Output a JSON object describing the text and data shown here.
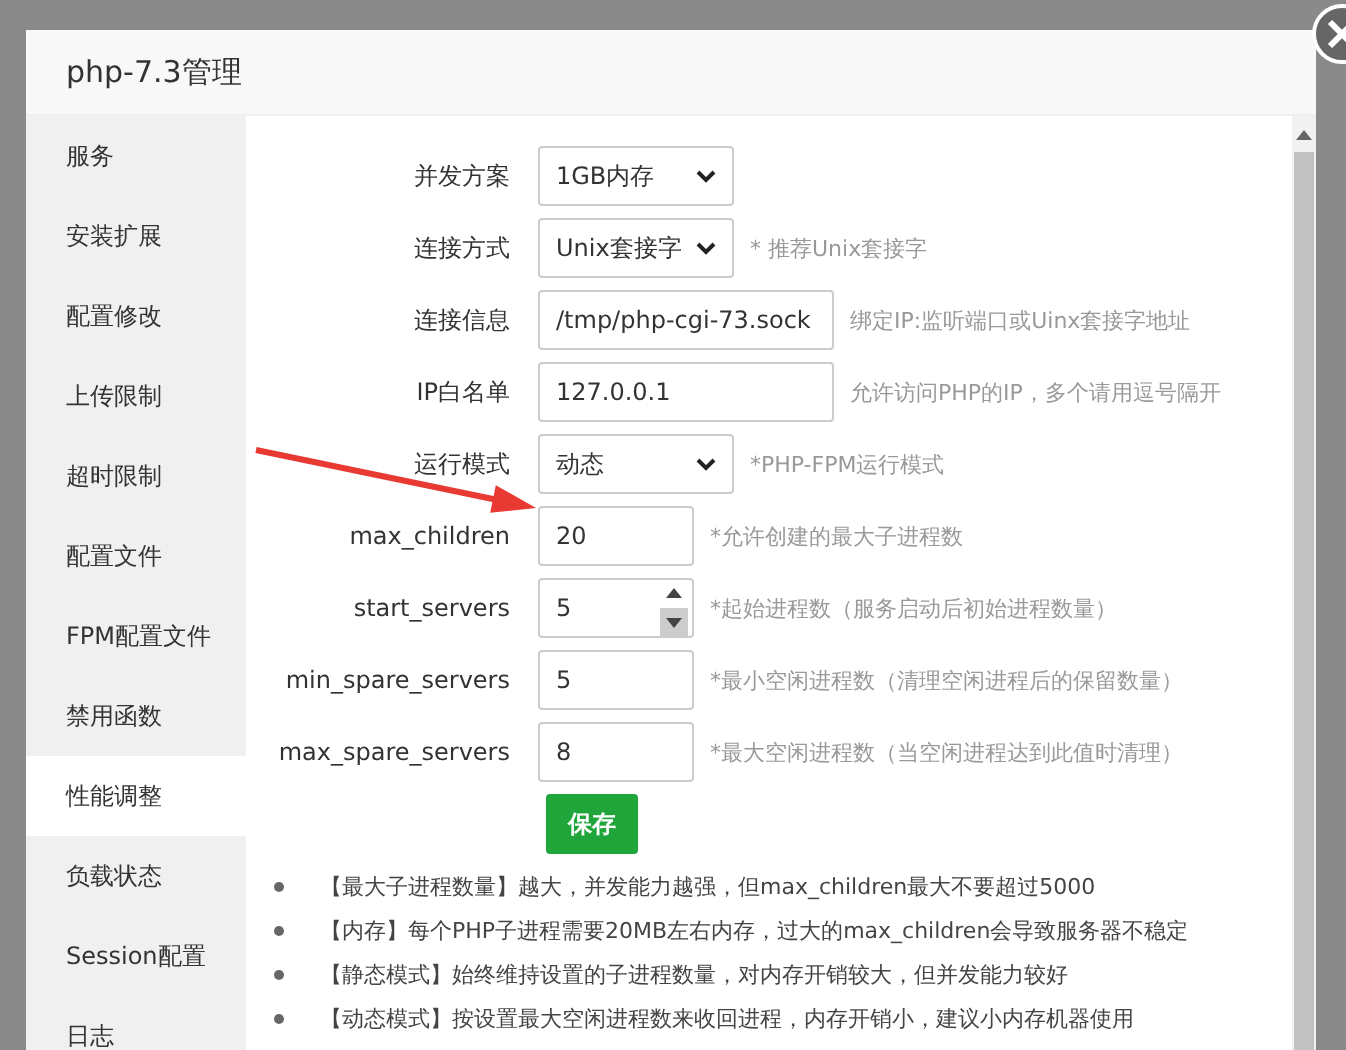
{
  "window": {
    "title": "php-7.3管理"
  },
  "sidebar": {
    "items": [
      {
        "label": "服务",
        "selected": false
      },
      {
        "label": "安装扩展",
        "selected": false
      },
      {
        "label": "配置修改",
        "selected": false
      },
      {
        "label": "上传限制",
        "selected": false
      },
      {
        "label": "超时限制",
        "selected": false
      },
      {
        "label": "配置文件",
        "selected": false
      },
      {
        "label": "FPM配置文件",
        "selected": false
      },
      {
        "label": "禁用函数",
        "selected": false
      },
      {
        "label": "性能调整",
        "selected": true
      },
      {
        "label": "负载状态",
        "selected": false
      },
      {
        "label": "Session配置",
        "selected": false
      },
      {
        "label": "日志",
        "selected": false
      }
    ]
  },
  "form": {
    "rows": [
      {
        "kind": "select",
        "label": "并发方案",
        "value": "1GB内存"
      },
      {
        "kind": "select",
        "label": "连接方式",
        "value": "Unix套接字",
        "hint": "* 推荐Unix套接字"
      },
      {
        "kind": "input",
        "label": "连接信息",
        "value": "/tmp/php-cgi-73.sock",
        "hint": "绑定IP:监听端口或Uinx套接字地址"
      },
      {
        "kind": "input",
        "label": "IP白名单",
        "value": "127.0.0.1",
        "hint": "允许访问PHP的IP，多个请用逗号隔开"
      },
      {
        "kind": "select",
        "label": "运行模式",
        "value": "动态",
        "hint": "*PHP-FPM运行模式"
      },
      {
        "kind": "input",
        "label": "max_children",
        "value": "20",
        "hint": "*允许创建的最大子进程数"
      },
      {
        "kind": "number",
        "label": "start_servers",
        "value": "5",
        "hint": "*起始进程数（服务启动后初始进程数量）"
      },
      {
        "kind": "input",
        "label": "min_spare_servers",
        "value": "5",
        "hint": "*最小空闲进程数（清理空闲进程后的保留数量）"
      },
      {
        "kind": "input",
        "label": "max_spare_servers",
        "value": "8",
        "hint": "*最大空闲进程数（当空闲进程达到此值时清理）"
      }
    ],
    "save_button": "保存"
  },
  "notes": [
    "【最大子进程数量】越大，并发能力越强，但max_children最大不要超过5000",
    "【内存】每个PHP子进程需要20MB左右内存，过大的max_children会导致服务器不稳定",
    "【静态模式】始终维持设置的子进程数量，对内存开销较大，但并发能力较好",
    "【动态模式】按设置最大空闲进程数来收回进程，内存开销小，建议小内存机器使用"
  ]
}
